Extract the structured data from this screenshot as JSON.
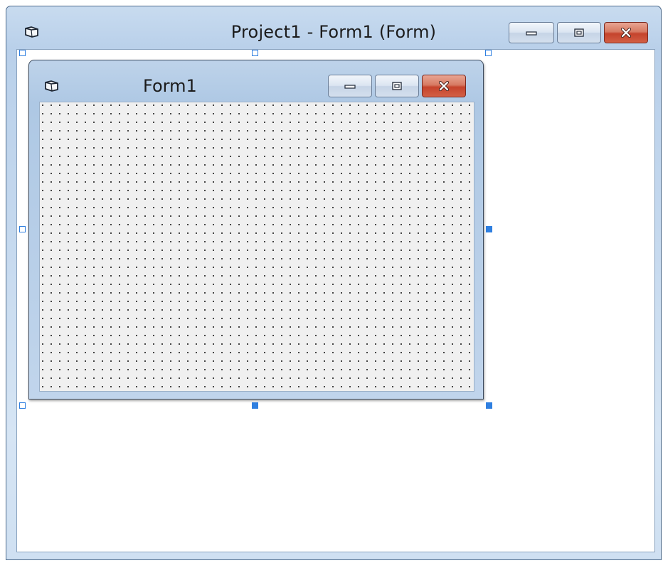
{
  "outer_window": {
    "title": "Project1 - Form1 (Form)",
    "icon": "form-icon",
    "buttons": [
      {
        "name": "minimize",
        "icon": "minimize-icon"
      },
      {
        "name": "maximize",
        "icon": "maximize-icon"
      },
      {
        "name": "close",
        "icon": "close-icon"
      }
    ]
  },
  "form": {
    "title": "Form1",
    "icon": "form-icon",
    "grid": "dotted",
    "buttons": [
      {
        "name": "minimize",
        "icon": "minimize-icon"
      },
      {
        "name": "maximize",
        "icon": "maximize-icon"
      },
      {
        "name": "close",
        "icon": "close-icon"
      }
    ]
  },
  "colors": {
    "selection_handle": "#2f7fe0",
    "close_button": "#c8462f",
    "title_bar": "#b9d0ea",
    "form_background": "#f0f0f0"
  }
}
